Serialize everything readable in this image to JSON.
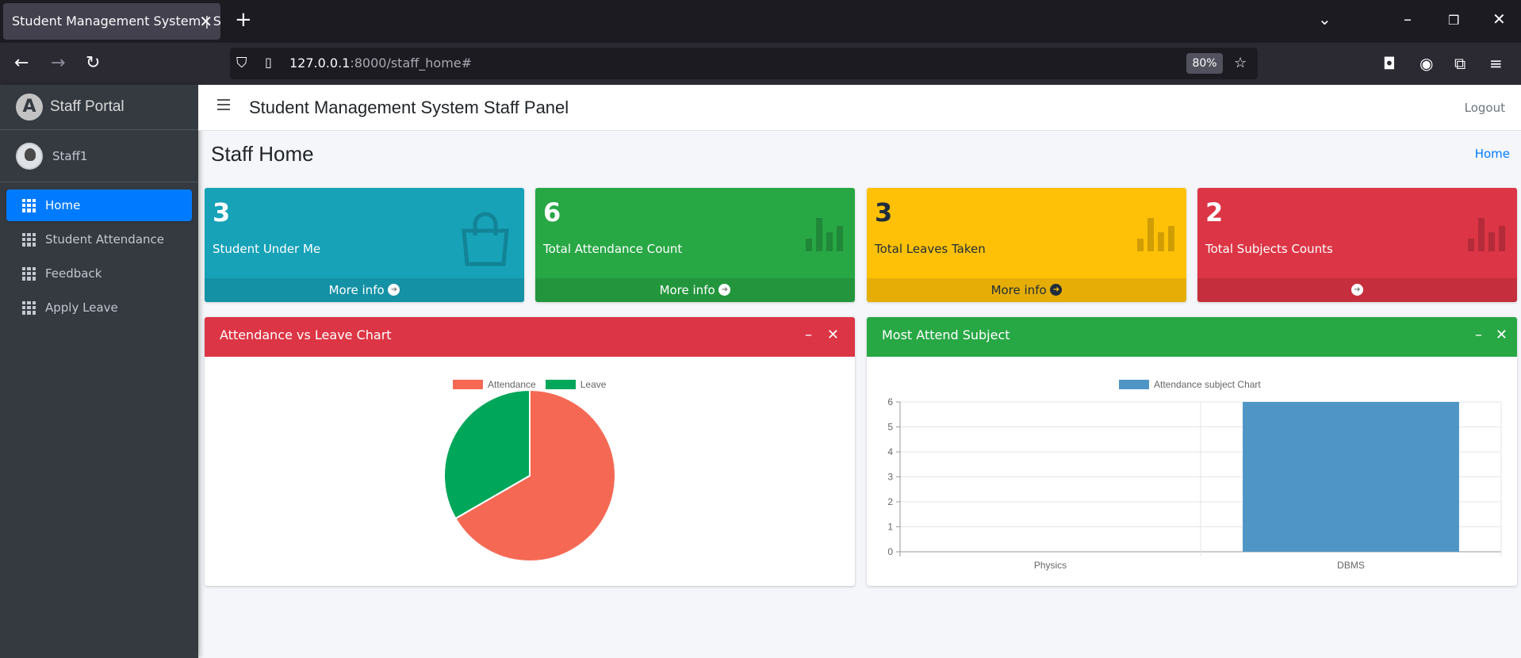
{
  "browser": {
    "tab_title": "Student Management System | Staff",
    "url_host": "127.0.0.1",
    "url_path": ":8000/staff_home#",
    "zoom": "80%"
  },
  "sidebar": {
    "brand": "Staff Portal",
    "user": "Staff1",
    "items": [
      {
        "label": "Home"
      },
      {
        "label": "Student Attendance"
      },
      {
        "label": "Feedback"
      },
      {
        "label": "Apply Leave"
      }
    ]
  },
  "header": {
    "title": "Student Management System Staff Panel",
    "logout": "Logout"
  },
  "page": {
    "title": "Staff Home",
    "breadcrumb": "Home"
  },
  "boxes": [
    {
      "value": "3",
      "label": "Student Under Me",
      "footer": "More info",
      "color": "#17a2b8",
      "icon": "shopping-bag-icon"
    },
    {
      "value": "6",
      "label": "Total Attendance Count",
      "footer": "More info",
      "color": "#28a745",
      "icon": "bar-chart-icon"
    },
    {
      "value": "3",
      "label": "Total Leaves Taken",
      "footer": "More info",
      "color": "#ffc107",
      "icon": "bar-chart-icon"
    },
    {
      "value": "2",
      "label": "Total Subjects Counts",
      "footer": "",
      "color": "#dc3545",
      "icon": "bar-chart-icon"
    }
  ],
  "cards": {
    "left_title": "Attendance vs Leave Chart",
    "right_title": "Most Attend Subject"
  },
  "chart_data": [
    {
      "type": "pie",
      "title": "",
      "categories": [
        "Attendance",
        "Leave"
      ],
      "values": [
        6,
        3
      ],
      "colors": [
        "#f56954",
        "#00a65a"
      ],
      "legend": "top"
    },
    {
      "type": "bar",
      "title": "",
      "categories": [
        "Physics",
        "DBMS"
      ],
      "series": [
        {
          "name": "Attendance subject Chart",
          "values": [
            0,
            6
          ]
        }
      ],
      "ylim": [
        0,
        6
      ],
      "yticks": [
        0,
        1,
        2,
        3,
        4,
        5,
        6
      ],
      "color": "#4f96c6",
      "grid": true,
      "legend": "top"
    }
  ]
}
